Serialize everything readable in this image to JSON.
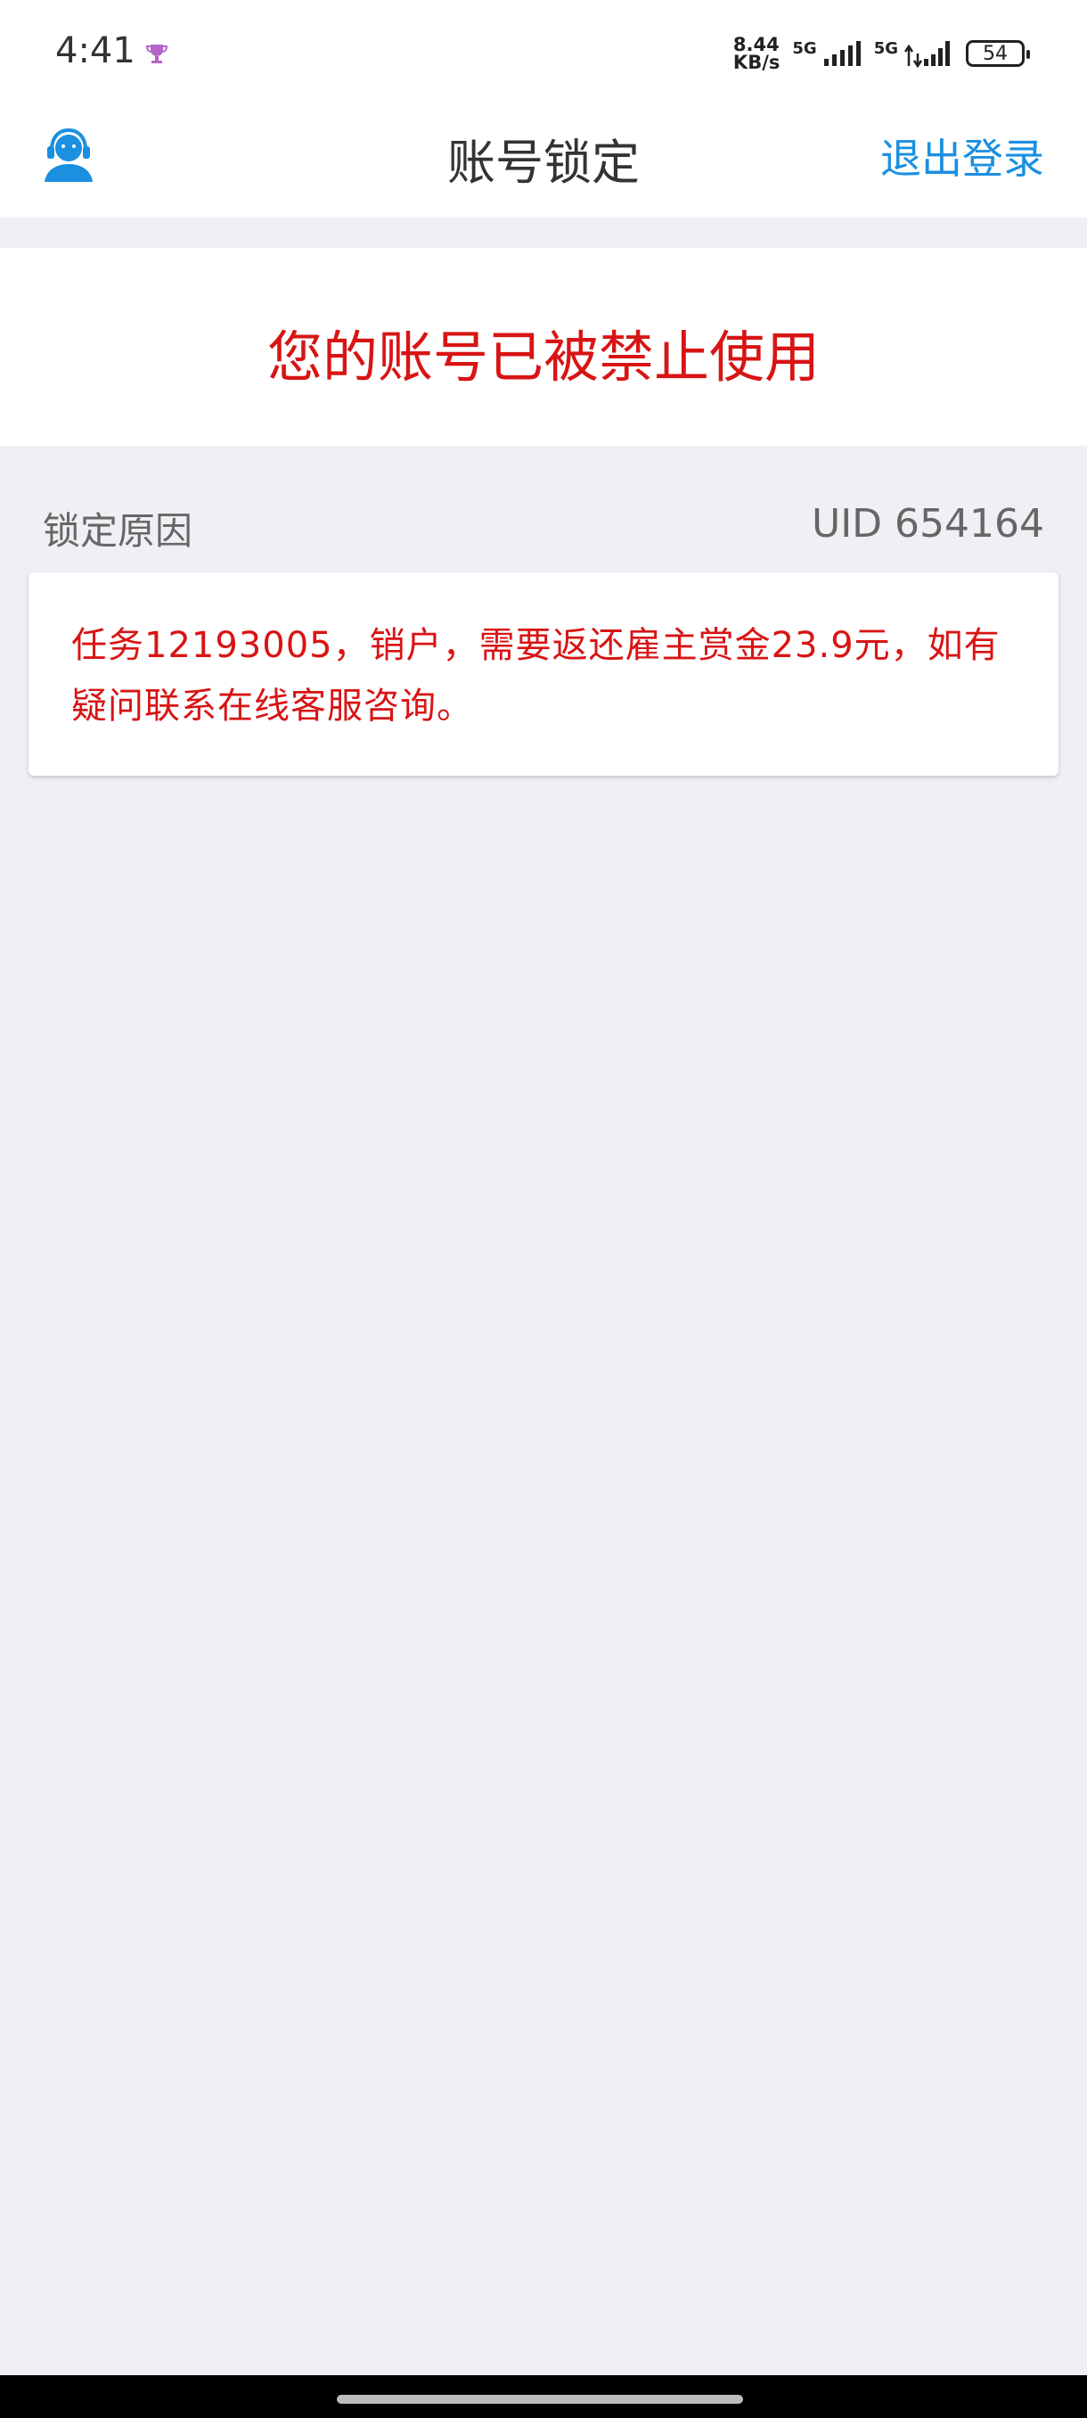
{
  "status_bar": {
    "time": "4:41",
    "app_icon": "trophy-icon",
    "net_speed_value": "8.44",
    "net_speed_unit": "KB/s",
    "sim1_label": "5G",
    "sim2_label": "5G",
    "battery": "54"
  },
  "header": {
    "title": "账号锁定",
    "support_icon": "customer-service-icon",
    "logout_label": "退出登录",
    "accent_color": "#1b8fe0"
  },
  "banner": {
    "message": "您的账号已被禁止使用",
    "color": "#d81414"
  },
  "reason_section": {
    "label": "锁定原因",
    "uid": "UID 654164",
    "reason": "任务12193005，销户，需要返还雇主赏金23.9元，如有疑问联系在线客服咨询。"
  }
}
